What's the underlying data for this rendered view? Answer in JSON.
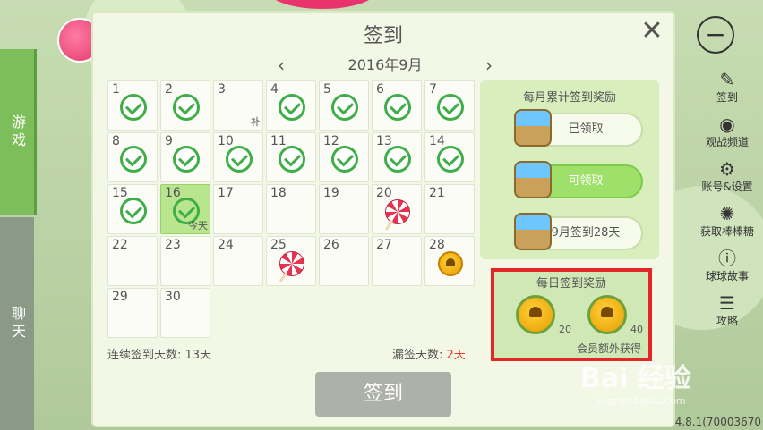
{
  "left_tabs": {
    "game": "游戏",
    "chat": "聊天"
  },
  "right_bar": {
    "items": [
      {
        "icon": "sign-icon",
        "glyph": "✎",
        "label": "签到"
      },
      {
        "icon": "eye-icon",
        "glyph": "◉",
        "label": "观战频道"
      },
      {
        "icon": "gear-icon",
        "glyph": "⚙",
        "label": "账号&设置"
      },
      {
        "icon": "pinwheel-icon",
        "glyph": "✺",
        "label": "获取棒棒糖"
      },
      {
        "icon": "info-icon",
        "glyph": "ⓘ",
        "label": "球球故事"
      },
      {
        "icon": "guide-icon",
        "glyph": "☰",
        "label": "攻略"
      }
    ],
    "version": "4.8.1(70003670"
  },
  "dialog": {
    "title": "签到",
    "month_label": "2016年9月",
    "days": [
      {
        "n": "1",
        "state": "checked"
      },
      {
        "n": "2",
        "state": "checked"
      },
      {
        "n": "3",
        "state": "missed",
        "tag": "补"
      },
      {
        "n": "4",
        "state": "checked"
      },
      {
        "n": "5",
        "state": "checked"
      },
      {
        "n": "6",
        "state": "checked"
      },
      {
        "n": "7",
        "state": "checked"
      },
      {
        "n": "8",
        "state": "checked"
      },
      {
        "n": "9",
        "state": "checked"
      },
      {
        "n": "10",
        "state": "checked"
      },
      {
        "n": "11",
        "state": "checked"
      },
      {
        "n": "12",
        "state": "checked"
      },
      {
        "n": "13",
        "state": "checked"
      },
      {
        "n": "14",
        "state": "checked"
      },
      {
        "n": "15",
        "state": "checked"
      },
      {
        "n": "16",
        "state": "today",
        "tag": "今天"
      },
      {
        "n": "17",
        "state": "empty"
      },
      {
        "n": "18",
        "state": "empty"
      },
      {
        "n": "19",
        "state": "empty"
      },
      {
        "n": "20",
        "state": "candy"
      },
      {
        "n": "21",
        "state": "empty"
      },
      {
        "n": "22",
        "state": "empty"
      },
      {
        "n": "23",
        "state": "empty"
      },
      {
        "n": "24",
        "state": "empty"
      },
      {
        "n": "25",
        "state": "candy"
      },
      {
        "n": "26",
        "state": "empty"
      },
      {
        "n": "27",
        "state": "empty"
      },
      {
        "n": "28",
        "state": "coin"
      },
      {
        "n": "29",
        "state": "empty"
      },
      {
        "n": "30",
        "state": "empty"
      }
    ],
    "continuous_label": "连续签到天数: 13天",
    "missed_label": "漏签天数: ",
    "missed_count": "2天",
    "sign_button": "签到",
    "monthly": {
      "title": "每月累计签到奖励",
      "rewards": [
        {
          "label": "已领取",
          "active": false
        },
        {
          "label": "可领取",
          "active": true
        },
        {
          "label": "9月签到28天",
          "active": false
        }
      ]
    },
    "daily": {
      "title": "每日签到奖励",
      "values": [
        "20",
        "40"
      ],
      "note": "会员额外获得"
    }
  },
  "watermark": {
    "text": "Bai 经验",
    "sub": "jingyan.baidu.com"
  }
}
